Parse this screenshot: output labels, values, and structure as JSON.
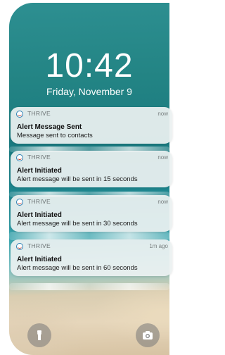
{
  "lock_screen": {
    "time": "10:42",
    "date": "Friday, November 9"
  },
  "notifications": [
    {
      "app": "THRIVE",
      "time": "now",
      "title": "Alert Message Sent",
      "body": "Message sent to contacts"
    },
    {
      "app": "THRIVE",
      "time": "now",
      "title": "Alert Initiated",
      "body": "Alert message will be sent in 15 seconds"
    },
    {
      "app": "THRIVE",
      "time": "now",
      "title": "Alert Initiated",
      "body": "Alert message will be sent in 30 seconds"
    },
    {
      "app": "THRIVE",
      "time": "1m ago",
      "title": "Alert Initiated",
      "body": "Alert message will be sent in 60 seconds"
    }
  ],
  "quick_actions": {
    "left_icon": "flashlight-icon",
    "right_icon": "camera-icon"
  },
  "colors": {
    "app_icon_ring": "#2c7fb3",
    "notification_bg": "#ecf1f1"
  }
}
